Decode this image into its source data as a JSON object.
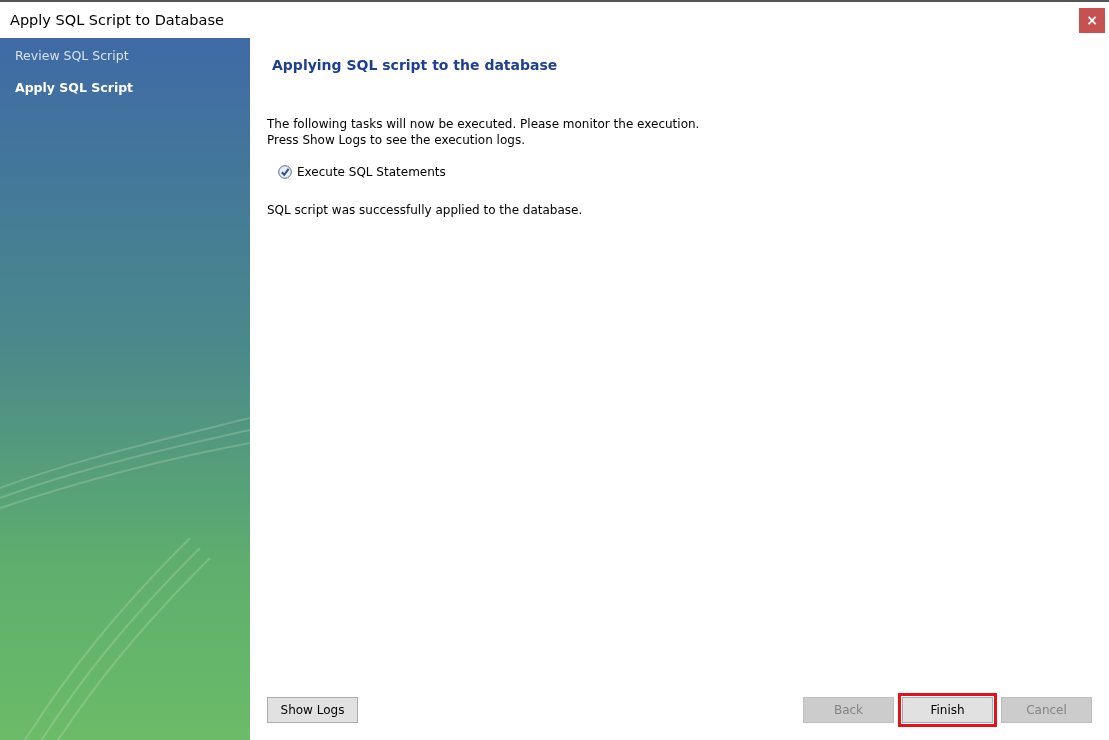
{
  "window": {
    "title": "Apply SQL Script to Database",
    "close_button": "×"
  },
  "sidebar": {
    "items": [
      {
        "label": "Review SQL Script",
        "selected": false
      },
      {
        "label": "Apply SQL Script",
        "selected": true
      }
    ]
  },
  "content": {
    "heading": "Applying SQL script to the database",
    "intro": [
      "The following tasks will now be executed. Please monitor the execution.",
      "Press Show Logs to see the execution logs."
    ],
    "tasks": [
      {
        "label": "Execute SQL Statements",
        "checked": true
      }
    ],
    "result": "SQL script was successfully applied to the database."
  },
  "buttons": [
    {
      "label": "Show Logs",
      "disabled": false,
      "highlighted": false,
      "kind": "left"
    },
    {
      "label": "Back",
      "disabled": true,
      "highlighted": false,
      "kind": "right"
    },
    {
      "label": "Finish",
      "disabled": false,
      "highlighted": true,
      "kind": "right"
    },
    {
      "label": "Cancel",
      "disabled": true,
      "highlighted": false,
      "kind": "right"
    }
  ]
}
